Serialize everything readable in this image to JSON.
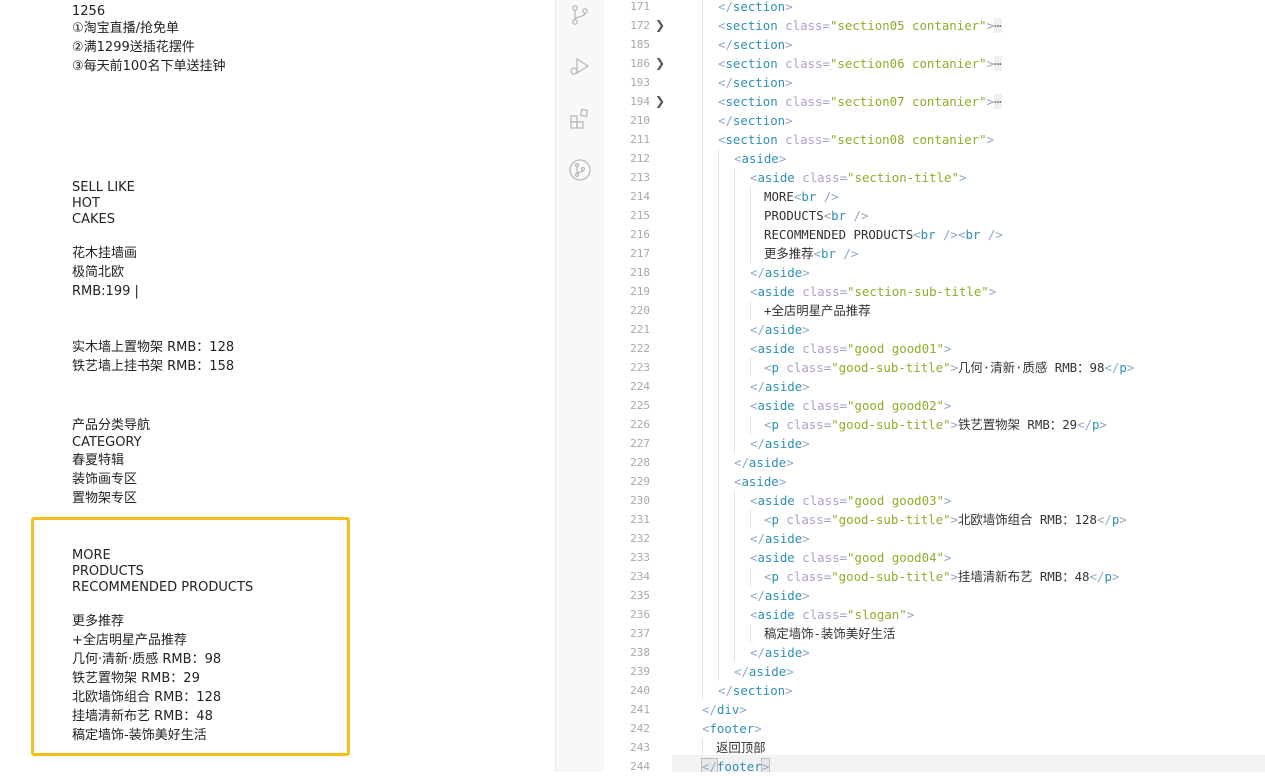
{
  "preview": {
    "lines": [
      "1256",
      "①淘宝直播/抢免单",
      "②满1299送插花摆件",
      "③每天前100名下单送挂钟",
      "SELL LIKE",
      "HOT",
      "CAKES",
      "花木挂墙画",
      "极简北欧",
      "RMB:199 |",
      "实木墙上置物架 RMB：128",
      "铁艺墙上挂书架 RMB：158",
      "产品分类导航",
      "CATEGORY",
      "春夏特辑",
      "装饰画专区",
      "置物架专区",
      "MORE",
      "PRODUCTS",
      "RECOMMENDED PRODUCTS",
      "更多推荐",
      "+全店明星产品推荐",
      "几何·清新·质感 RMB：98",
      "铁艺置物架 RMB：29",
      "北欧墙饰组合 RMB：128",
      "挂墙清新布艺 RMB：48",
      "稿定墙饰-装饰美好生活"
    ],
    "highlight_color": "#f5bd1d"
  },
  "activity_bar": {
    "icons": [
      "source-control-icon",
      "run-debug-icon",
      "extensions-icon",
      "git-graph-icon"
    ]
  },
  "editor": {
    "line_numbers": [
      "171",
      "172",
      "185",
      "186",
      "193",
      "194",
      "210",
      "211",
      "212",
      "213",
      "214",
      "215",
      "216",
      "217",
      "218",
      "219",
      "220",
      "221",
      "222",
      "223",
      "224",
      "225",
      "226",
      "227",
      "228",
      "229",
      "230",
      "231",
      "232",
      "233",
      "234",
      "235",
      "236",
      "237",
      "238",
      "239",
      "240",
      "241",
      "242",
      "243",
      "244"
    ],
    "folded_lines": [
      "172",
      "186",
      "194"
    ],
    "lines": [
      [
        [
          "pun",
          "</"
        ],
        [
          "tag",
          "section"
        ],
        [
          "pun",
          ">"
        ]
      ],
      [
        [
          "pun",
          "<"
        ],
        [
          "tag",
          "section"
        ],
        [
          "txt",
          " "
        ],
        [
          "attr",
          "class"
        ],
        [
          "pun",
          "="
        ],
        [
          "str",
          "\"section05 contanier\""
        ],
        [
          "pun",
          ">"
        ],
        [
          "fold",
          "⋯"
        ]
      ],
      [
        [
          "pun",
          "</"
        ],
        [
          "tag",
          "section"
        ],
        [
          "pun",
          ">"
        ]
      ],
      [
        [
          "pun",
          "<"
        ],
        [
          "tag",
          "section"
        ],
        [
          "txt",
          " "
        ],
        [
          "attr",
          "class"
        ],
        [
          "pun",
          "="
        ],
        [
          "str",
          "\"section06 contanier\""
        ],
        [
          "pun",
          ">"
        ],
        [
          "fold",
          "⋯"
        ]
      ],
      [
        [
          "pun",
          "</"
        ],
        [
          "tag",
          "section"
        ],
        [
          "pun",
          ">"
        ]
      ],
      [
        [
          "pun",
          "<"
        ],
        [
          "tag",
          "section"
        ],
        [
          "txt",
          " "
        ],
        [
          "attr",
          "class"
        ],
        [
          "pun",
          "="
        ],
        [
          "str",
          "\"section07 contanier\""
        ],
        [
          "pun",
          ">"
        ],
        [
          "fold",
          "⋯"
        ]
      ],
      [
        [
          "pun",
          "</"
        ],
        [
          "tag",
          "section"
        ],
        [
          "pun",
          ">"
        ]
      ],
      [
        [
          "pun",
          "<"
        ],
        [
          "tag",
          "section"
        ],
        [
          "txt",
          " "
        ],
        [
          "attr",
          "class"
        ],
        [
          "pun",
          "="
        ],
        [
          "str",
          "\"section08 contanier\""
        ],
        [
          "pun",
          ">"
        ]
      ],
      [
        [
          "pun",
          "<"
        ],
        [
          "tag",
          "aside"
        ],
        [
          "pun",
          ">"
        ]
      ],
      [
        [
          "pun",
          "<"
        ],
        [
          "tag",
          "aside"
        ],
        [
          "txt",
          " "
        ],
        [
          "attr",
          "class"
        ],
        [
          "pun",
          "="
        ],
        [
          "str",
          "\"section-title\""
        ],
        [
          "pun",
          ">"
        ]
      ],
      [
        [
          "txt",
          "MORE"
        ],
        [
          "pun",
          "<"
        ],
        [
          "tag",
          "br"
        ],
        [
          "txt",
          " "
        ],
        [
          "pun",
          "/>"
        ]
      ],
      [
        [
          "txt",
          "PRODUCTS"
        ],
        [
          "pun",
          "<"
        ],
        [
          "tag",
          "br"
        ],
        [
          "txt",
          " "
        ],
        [
          "pun",
          "/>"
        ]
      ],
      [
        [
          "txt",
          "RECOMMENDED PRODUCTS"
        ],
        [
          "pun",
          "<"
        ],
        [
          "tag",
          "br"
        ],
        [
          "txt",
          " "
        ],
        [
          "pun",
          "/><"
        ],
        [
          "tag",
          "br"
        ],
        [
          "txt",
          " "
        ],
        [
          "pun",
          "/>"
        ]
      ],
      [
        [
          "txt",
          "更多推荐"
        ],
        [
          "pun",
          "<"
        ],
        [
          "tag",
          "br"
        ],
        [
          "txt",
          " "
        ],
        [
          "pun",
          "/>"
        ]
      ],
      [
        [
          "pun",
          "</"
        ],
        [
          "tag",
          "aside"
        ],
        [
          "pun",
          ">"
        ]
      ],
      [
        [
          "pun",
          "<"
        ],
        [
          "tag",
          "aside"
        ],
        [
          "txt",
          " "
        ],
        [
          "attr",
          "class"
        ],
        [
          "pun",
          "="
        ],
        [
          "str",
          "\"section-sub-title\""
        ],
        [
          "pun",
          ">"
        ]
      ],
      [
        [
          "txt",
          "+全店明星产品推荐"
        ]
      ],
      [
        [
          "pun",
          "</"
        ],
        [
          "tag",
          "aside"
        ],
        [
          "pun",
          ">"
        ]
      ],
      [
        [
          "pun",
          "<"
        ],
        [
          "tag",
          "aside"
        ],
        [
          "txt",
          " "
        ],
        [
          "attr",
          "class"
        ],
        [
          "pun",
          "="
        ],
        [
          "str",
          "\"good good01\""
        ],
        [
          "pun",
          ">"
        ]
      ],
      [
        [
          "pun",
          "<"
        ],
        [
          "tag",
          "p"
        ],
        [
          "txt",
          " "
        ],
        [
          "attr",
          "class"
        ],
        [
          "pun",
          "="
        ],
        [
          "str",
          "\"good-sub-title\""
        ],
        [
          "pun",
          ">"
        ],
        [
          "txt",
          "几何·清新·质感 RMB：98"
        ],
        [
          "pun",
          "</"
        ],
        [
          "tag",
          "p"
        ],
        [
          "pun",
          ">"
        ]
      ],
      [
        [
          "pun",
          "</"
        ],
        [
          "tag",
          "aside"
        ],
        [
          "pun",
          ">"
        ]
      ],
      [
        [
          "pun",
          "<"
        ],
        [
          "tag",
          "aside"
        ],
        [
          "txt",
          " "
        ],
        [
          "attr",
          "class"
        ],
        [
          "pun",
          "="
        ],
        [
          "str",
          "\"good good02\""
        ],
        [
          "pun",
          ">"
        ]
      ],
      [
        [
          "pun",
          "<"
        ],
        [
          "tag",
          "p"
        ],
        [
          "txt",
          " "
        ],
        [
          "attr",
          "class"
        ],
        [
          "pun",
          "="
        ],
        [
          "str",
          "\"good-sub-title\""
        ],
        [
          "pun",
          ">"
        ],
        [
          "txt",
          "铁艺置物架 RMB：29"
        ],
        [
          "pun",
          "</"
        ],
        [
          "tag",
          "p"
        ],
        [
          "pun",
          ">"
        ]
      ],
      [
        [
          "pun",
          "</"
        ],
        [
          "tag",
          "aside"
        ],
        [
          "pun",
          ">"
        ]
      ],
      [
        [
          "pun",
          "</"
        ],
        [
          "tag",
          "aside"
        ],
        [
          "pun",
          ">"
        ]
      ],
      [
        [
          "pun",
          "<"
        ],
        [
          "tag",
          "aside"
        ],
        [
          "pun",
          ">"
        ]
      ],
      [
        [
          "pun",
          "<"
        ],
        [
          "tag",
          "aside"
        ],
        [
          "txt",
          " "
        ],
        [
          "attr",
          "class"
        ],
        [
          "pun",
          "="
        ],
        [
          "str",
          "\"good good03\""
        ],
        [
          "pun",
          ">"
        ]
      ],
      [
        [
          "pun",
          "<"
        ],
        [
          "tag",
          "p"
        ],
        [
          "txt",
          " "
        ],
        [
          "attr",
          "class"
        ],
        [
          "pun",
          "="
        ],
        [
          "str",
          "\"good-sub-title\""
        ],
        [
          "pun",
          ">"
        ],
        [
          "txt",
          "北欧墙饰组合 RMB：128"
        ],
        [
          "pun",
          "</"
        ],
        [
          "tag",
          "p"
        ],
        [
          "pun",
          ">"
        ]
      ],
      [
        [
          "pun",
          "</"
        ],
        [
          "tag",
          "aside"
        ],
        [
          "pun",
          ">"
        ]
      ],
      [
        [
          "pun",
          "<"
        ],
        [
          "tag",
          "aside"
        ],
        [
          "txt",
          " "
        ],
        [
          "attr",
          "class"
        ],
        [
          "pun",
          "="
        ],
        [
          "str",
          "\"good good04\""
        ],
        [
          "pun",
          ">"
        ]
      ],
      [
        [
          "pun",
          "<"
        ],
        [
          "tag",
          "p"
        ],
        [
          "txt",
          " "
        ],
        [
          "attr",
          "class"
        ],
        [
          "pun",
          "="
        ],
        [
          "str",
          "\"good-sub-title\""
        ],
        [
          "pun",
          ">"
        ],
        [
          "txt",
          "挂墙清新布艺 RMB：48"
        ],
        [
          "pun",
          "</"
        ],
        [
          "tag",
          "p"
        ],
        [
          "pun",
          ">"
        ]
      ],
      [
        [
          "pun",
          "</"
        ],
        [
          "tag",
          "aside"
        ],
        [
          "pun",
          ">"
        ]
      ],
      [
        [
          "pun",
          "<"
        ],
        [
          "tag",
          "aside"
        ],
        [
          "txt",
          " "
        ],
        [
          "attr",
          "class"
        ],
        [
          "pun",
          "="
        ],
        [
          "str",
          "\"slogan\""
        ],
        [
          "pun",
          ">"
        ]
      ],
      [
        [
          "txt",
          "稿定墙饰-装饰美好生活"
        ]
      ],
      [
        [
          "pun",
          "</"
        ],
        [
          "tag",
          "aside"
        ],
        [
          "pun",
          ">"
        ]
      ],
      [
        [
          "pun",
          "</"
        ],
        [
          "tag",
          "aside"
        ],
        [
          "pun",
          ">"
        ]
      ],
      [
        [
          "pun",
          "</"
        ],
        [
          "tag",
          "section"
        ],
        [
          "pun",
          ">"
        ]
      ],
      [
        [
          "pun",
          "</"
        ],
        [
          "tag",
          "div"
        ],
        [
          "pun",
          ">"
        ]
      ],
      [
        [
          "pun",
          "<"
        ],
        [
          "tag",
          "footer"
        ],
        [
          "pun",
          ">"
        ]
      ],
      [
        [
          "txt",
          "返回顶部"
        ]
      ],
      [
        [
          "pun",
          "</"
        ],
        [
          "tag",
          "footer"
        ],
        [
          "pun",
          ">"
        ]
      ]
    ]
  }
}
